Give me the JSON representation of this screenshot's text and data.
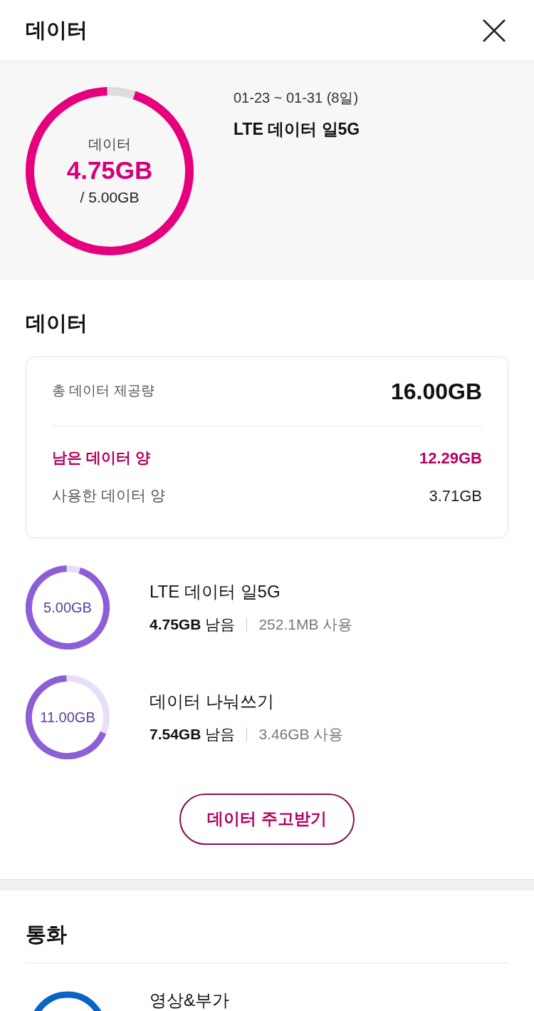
{
  "header": {
    "title": "데이터"
  },
  "summary": {
    "ring_label": "데이터",
    "ring_value": "4.75GB",
    "ring_total": "/ 5.00GB",
    "level": 0.95,
    "period": "01-23 ~ 01-31 (8일)",
    "plan": "LTE 데이터 일5G"
  },
  "data_section": {
    "title": "데이터",
    "totals": [
      {
        "kind": "total",
        "label": "총 데이터 제공량",
        "value": "16.00GB"
      },
      {
        "kind": "remaining",
        "label": "남은 데이터 양",
        "value": "12.29GB"
      },
      {
        "kind": "used",
        "label": "사용한 데이터 양",
        "value": "3.71GB"
      }
    ],
    "plans": [
      {
        "ring_text": "5.00GB",
        "level": 0.95,
        "name": "LTE 데이터 일5G",
        "remaining": "4.75GB",
        "remaining_suffix": "남음",
        "used": "252.1MB 사용"
      },
      {
        "ring_text": "11.00GB",
        "level": 0.685,
        "name": "데이터 나눠쓰기",
        "remaining": "7.54GB",
        "remaining_suffix": "남음",
        "used": "3.46GB 사용"
      }
    ],
    "button": "데이터 주고받기"
  },
  "call_section": {
    "title": "통화",
    "items": [
      {
        "name": "영상&부가"
      }
    ]
  }
}
